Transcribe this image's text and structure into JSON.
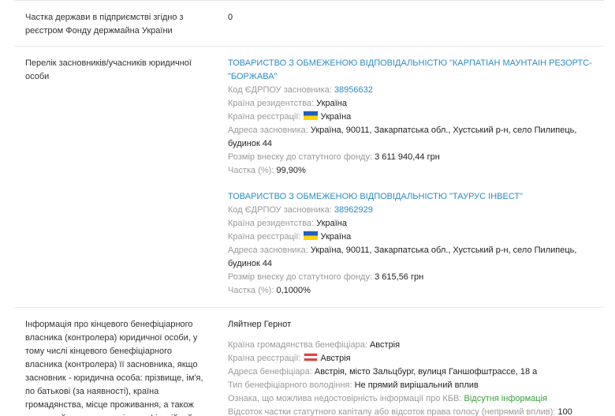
{
  "state_share": {
    "label": "Частка держави в підприємстві згідно з реєстром Фонду держмайна України",
    "value": "0"
  },
  "founders": {
    "label": "Перелік засновників/учасників юридичної особи",
    "items": [
      {
        "name": "ТОВАРИСТВО З ОБМЕЖЕНОЮ ВІДПОВІДАЛЬНІСТЮ \"КАРПАТІАН МАУНТАІН РЕЗОРТС-\"БОРЖАВА\"",
        "code_label": "Код ЄДРПОУ засновника:",
        "code": "38956632",
        "residence_label": "Країна резидентства:",
        "residence": "Україна",
        "registration_label": "Країна реєстрації:",
        "registration": "Україна",
        "address_label": "Адреса засновника:",
        "address": "Україна, 90011, Закарпатська обл., Хустський р-н, село Пилипець, будинок 44",
        "contribution_label": "Розмір внеску до статутного фонду:",
        "contribution": "3 611 940,44 грн",
        "share_label": "Частка (%):",
        "share": "99,90%"
      },
      {
        "name": "ТОВАРИСТВО З ОБМЕЖЕНОЮ ВІДПОВІДАЛЬНІСТЮ \"ТАУРУС ІНВЕСТ\"",
        "code_label": "Код ЄДРПОУ засновника:",
        "code": "38962929",
        "residence_label": "Країна резидентства:",
        "residence": "Україна",
        "registration_label": "Країна реєстрації:",
        "registration": "Україна",
        "address_label": "Адреса засновника:",
        "address": "Україна, 90011, Закарпатська обл., Хустський р-н, село Пилипець, будинок 44",
        "contribution_label": "Розмір внеску до статутного фонду:",
        "contribution": "3 615,56 грн",
        "share_label": "Частка (%):",
        "share": "0,1000%"
      }
    ]
  },
  "beneficiary": {
    "label": "Інформація про кінцевого бенефіціарного власника (контролера) юридичної особи, у тому числі кінцевого бенефіціарного власника (контролера) її засновника, якщо засновник - юридична особа: прізвище, ім'я, по батькові (за наявності), країна громадянства, місце проживання, а також повне найменування та ідентифікаційний",
    "name": "Ляйтнер Гернот",
    "citizenship_label": "Країна громадянства бенефіціара:",
    "citizenship": "Австрія",
    "registration_label": "Країна реєстрації:",
    "registration": "Австрія",
    "address_label": "Адреса бенефіціара:",
    "address": "Австрія, місто Зальцбург, вулиця Ганшофштрассе, 18 а",
    "ownership_type_label": "Тип бенефіціарного володіння:",
    "ownership_type": "Не прямий вирішальний вплив",
    "unreliability_label": "Ознака, що можлива недостовірність інформації про КБВ:",
    "unreliability": "Відсутня інформація",
    "percent_label": "Відсоток частки статутного капіталу або відсоток права голосу (непрямий вплив):",
    "percent": "100"
  }
}
